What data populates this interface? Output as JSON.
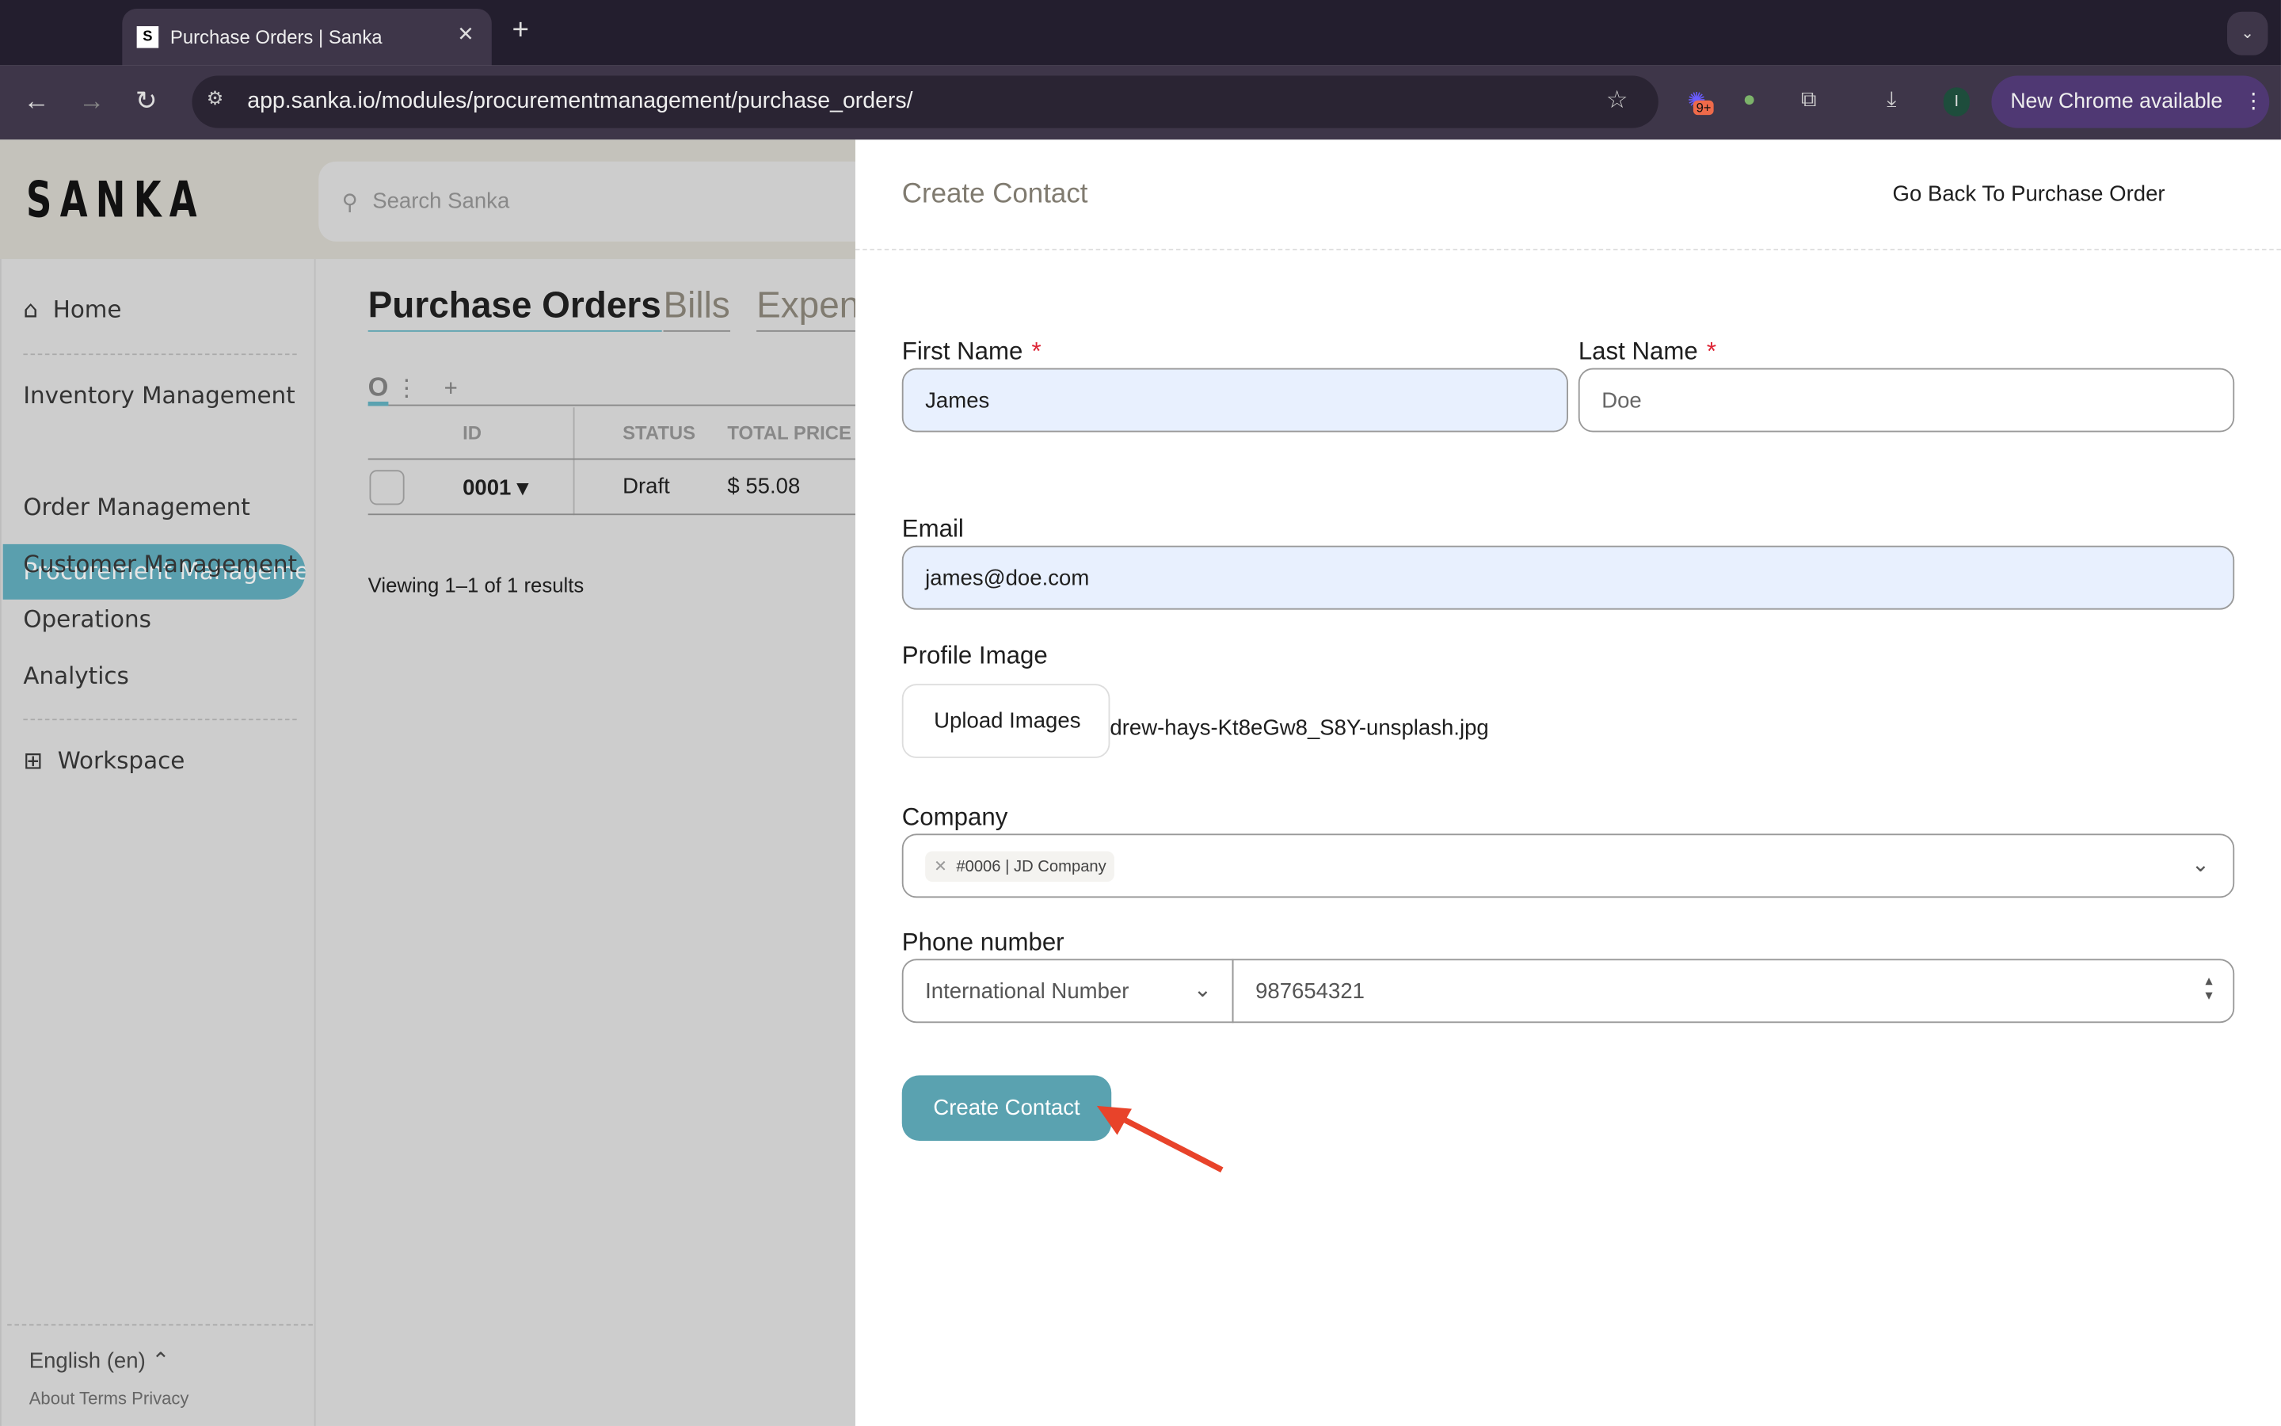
{
  "browser": {
    "tab_title": "Purchase Orders | Sanka",
    "favicon": "S",
    "url": "app.sanka.io/modules/procurementmanagement/purchase_orders/",
    "update_label": "New Chrome available",
    "ext_badge": "9+",
    "profile_initial": "I"
  },
  "app": {
    "logo": "SANKA",
    "search_placeholder": "Search Sanka",
    "sidebar": {
      "home": "Home",
      "items": [
        "Inventory Management",
        "Procurement Management",
        "Order Management",
        "Customer Management",
        "Operations",
        "Analytics"
      ],
      "workspace": "Workspace",
      "language": "English (en)",
      "footer_links": "About Terms Privacy"
    },
    "tabs": [
      "Purchase Orders",
      "Bills",
      "Expenses"
    ],
    "table": {
      "headers": [
        "ID",
        "STATUS",
        "TOTAL PRICE"
      ],
      "rows": [
        {
          "id": "0001",
          "status": "Draft",
          "total": "$ 55.08"
        }
      ]
    },
    "results": "Viewing 1–1 of 1 results"
  },
  "panel": {
    "title": "Create Contact",
    "back_link": "Go Back To Purchase Order",
    "first_name_label": "First Name",
    "first_name": "James",
    "last_name_label": "Last Name",
    "last_name_placeholder": "Doe",
    "required_mark": "*",
    "email_label": "Email",
    "email": "james@doe.com",
    "profile_label": "Profile Image",
    "upload_label": "Upload Images",
    "file_name": "drew-hays-Kt8eGw8_S8Y-unsplash.jpg",
    "company_label": "Company",
    "company_tag": "#0006 | JD Company",
    "phone_label": "Phone number",
    "phone_type": "International Number",
    "phone": "987654321",
    "submit": "Create Contact"
  },
  "colors": {
    "accent": "#5aa2b0",
    "arrow": "#e8432a"
  }
}
